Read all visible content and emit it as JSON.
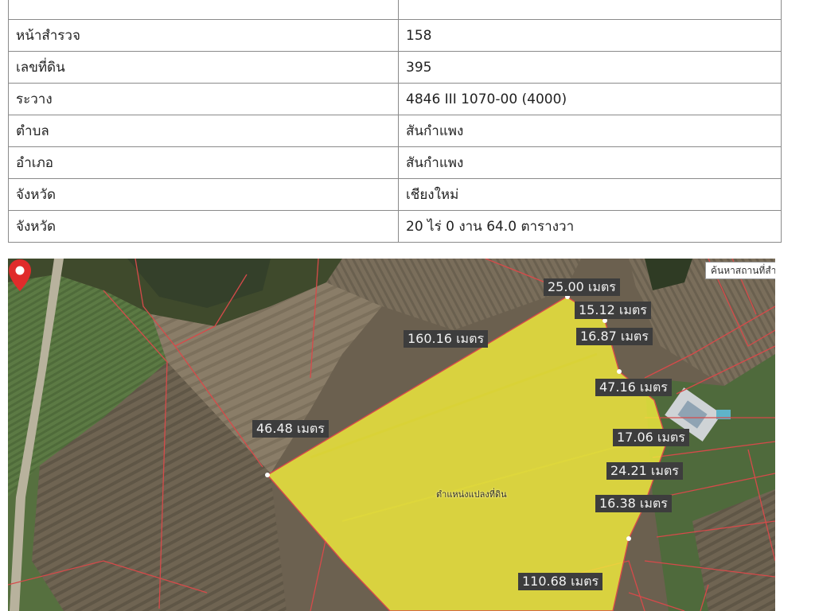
{
  "land_table": {
    "rows": [
      {
        "label": "",
        "value": ""
      },
      {
        "label": "หน้าสำรวจ",
        "value": "158"
      },
      {
        "label": "เลขที่ดิน",
        "value": "395"
      },
      {
        "label": "ระวาง",
        "value": "4846 III 1070-00 (4000)"
      },
      {
        "label": "ตำบล",
        "value": "สันกำแพง"
      },
      {
        "label": "อำเภอ",
        "value": "สันกำแพง"
      },
      {
        "label": "จังหวัด",
        "value": "เชียงใหม่"
      },
      {
        "label": "จังหวัด",
        "value": "20 ไร่ 0 งาน 64.0 ตารางวา"
      }
    ]
  },
  "map": {
    "search_placeholder": "ค้นหาสถานที่สำ",
    "place_label": "ตำแหน่งแปลงที่ดิน",
    "pin_icon": "map-pin-icon",
    "parcel_color": "#f2ec3c",
    "boundary_color": "#d64a4a",
    "pin_color": "#e02b2b",
    "measurements": [
      {
        "label": "25.00 เมตร"
      },
      {
        "label": "15.12 เมตร"
      },
      {
        "label": "160.16 เมตร"
      },
      {
        "label": "16.87 เมตร"
      },
      {
        "label": "47.16 เมตร"
      },
      {
        "label": "46.48 เมตร"
      },
      {
        "label": "17.06 เมตร"
      },
      {
        "label": "24.21 เมตร"
      },
      {
        "label": "16.38 เมตร"
      },
      {
        "label": "110.68 เมตร"
      }
    ]
  }
}
